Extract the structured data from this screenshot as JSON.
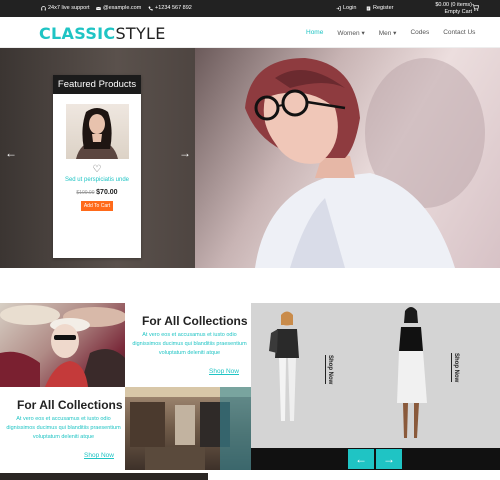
{
  "topbar": {
    "support": "24x7 live support",
    "email": "@example.com",
    "phone": "+1234 567 892",
    "login": "Login",
    "register": "Register",
    "cart_total": "$0.00 (0 items)",
    "cart_empty": "Empty Cart"
  },
  "header": {
    "logo_part1": "CLASSIC",
    "logo_part2": "STYLE",
    "nav": {
      "home": "Home",
      "women": "Women",
      "men": "Men",
      "codes": "Codes",
      "contact": "Contact Us"
    }
  },
  "hero": {
    "prev": "←",
    "next": "→",
    "featured": {
      "title": "Featured Products",
      "product_name": "Sed ut perspiciatis unde",
      "old_price": "$100.00",
      "new_price": "$70.00",
      "add_to_cart": "Add To Cart"
    }
  },
  "collections": [
    {
      "title": "For All Collections",
      "text": "At vero eos et accusamus et iusto odio dignissimos ducimus qui blanditiis praesentium voluptatum deleniti atque",
      "link": "Shop Now"
    },
    {
      "title": "For All Collections",
      "text": "At vero eos et accusamus et iusto odio dignissimos ducimus qui blanditiis praesentium voluptatum deleniti atque",
      "link": "Shop Now"
    }
  ],
  "models": {
    "shop_now_1": "Shop Now",
    "shop_now_2": "Shop Now",
    "prev": "←",
    "next": "→"
  },
  "colors": {
    "accent": "#1fc4c4",
    "button": "#ff6a1a",
    "topbar": "#222222"
  }
}
